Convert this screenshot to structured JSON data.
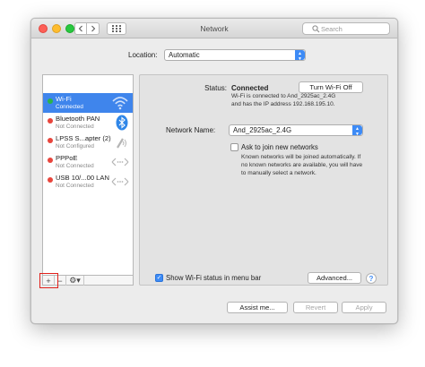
{
  "window": {
    "title": "Network"
  },
  "titlebar": {
    "back_icon": "chevron-left-icon",
    "forward_icon": "chevron-right-icon",
    "grid_icon": "grid-icon",
    "search_placeholder": "Search"
  },
  "location": {
    "label": "Location:",
    "value": "Automatic"
  },
  "services": [
    {
      "name": "Wi-Fi",
      "status": "Connected",
      "dot_color": "#2bb34b",
      "icon": "wifi-icon",
      "selected": true
    },
    {
      "name": "Bluetooth PAN",
      "status": "Not Connected",
      "dot_color": "#e8453c",
      "icon": "bluetooth-icon",
      "selected": false
    },
    {
      "name": "LPSS S...apter (2)",
      "status": "Not Configured",
      "dot_color": "#e8453c",
      "icon": "phone-icon",
      "selected": false
    },
    {
      "name": "PPPoE",
      "status": "Not Connected",
      "dot_color": "#e8453c",
      "icon": "ethernet-icon",
      "selected": false
    },
    {
      "name": "USB 10/...00 LAN",
      "status": "Not Connected",
      "dot_color": "#e8453c",
      "icon": "ethernet-icon",
      "selected": false
    }
  ],
  "sidebar_toolbar": {
    "add": "+",
    "remove": "−",
    "gear": "⚙▾"
  },
  "detail": {
    "status_label": "Status:",
    "status_value": "Connected",
    "turn_off_button": "Turn Wi-Fi Off",
    "status_desc_line1": "Wi-Fi is connected to And_2925ac_2.4G",
    "status_desc_line2": "and has the IP address 192.168.195.10.",
    "network_name_label": "Network Name:",
    "network_name_value": "And_2925ac_2.4G",
    "ask_join_label": "Ask to join new networks",
    "ask_join_desc_1": "Known networks will be joined automatically. If",
    "ask_join_desc_2": "no known networks are available, you will have",
    "ask_join_desc_3": "to manually select a network.",
    "show_wifi_label": "Show Wi-Fi status in menu bar",
    "advanced_button": "Advanced...",
    "help_button": "?"
  },
  "footer": {
    "assist_button": "Assist me...",
    "revert_button": "Revert",
    "apply_button": "Apply"
  },
  "colors": {
    "accent": "#3f85ec",
    "highlight_frame": "#e0201b"
  }
}
